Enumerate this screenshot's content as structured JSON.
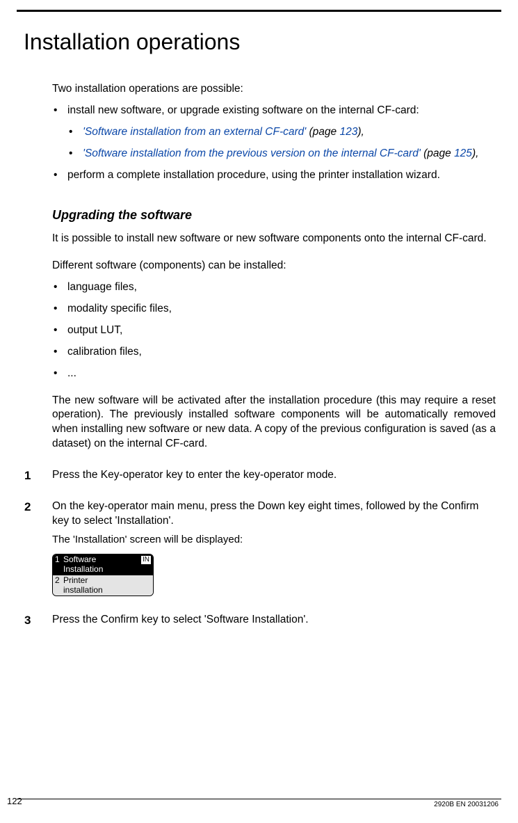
{
  "title": "Installation operations",
  "intro": "Two installation operations are possible:",
  "bullets": {
    "b1": "install new software, or upgrade existing software on the internal CF-card:",
    "b1a_link": "'Software installation from an external CF-card'",
    "b1a_page_open": " (page ",
    "b1a_page": "123",
    "b1a_close": "),",
    "b1b_link": "'Software installation from the previous version on the internal CF-card'",
    "b1b_page_open": "(page ",
    "b1b_page": "125",
    "b1b_close": "),",
    "b2": "perform a complete installation procedure, using the printer installation wizard."
  },
  "subheading": "Upgrading the software",
  "p1": "It is possible to install new software or new software components onto the internal CF-card.",
  "p2": "Different software (components) can be installed:",
  "comp": {
    "c1": "language files,",
    "c2": "modality specific files,",
    "c3": "output LUT,",
    "c4": "calibration files,",
    "c5": "..."
  },
  "p3": "The new software will be activated after the installation procedure (this may require a reset operation). The previously installed software components will be automatically removed when installing new software or new data. A copy of the previous configuration is saved (as a dataset) on the internal CF-card.",
  "steps": {
    "s1_num": "1",
    "s1": "Press the Key-operator key to enter the key-operator mode.",
    "s2_num": "2",
    "s2": "On the key-operator main menu, press the Down key eight times, followed by the Confirm key to select 'Installation'.",
    "s2_after": "The 'Installation' screen will be displayed:",
    "s3_num": "3",
    "s3": "Press the Confirm key to select 'Software Installation'."
  },
  "screen": {
    "row1_idx": "1",
    "row1_l1": "Software",
    "row1_l2": "Installation",
    "row1_tag": "IN",
    "row2_idx": "2",
    "row2_l1": "Printer",
    "row2_l2": "installation"
  },
  "footer": {
    "page": "122",
    "docid": "2920B EN 20031206"
  }
}
